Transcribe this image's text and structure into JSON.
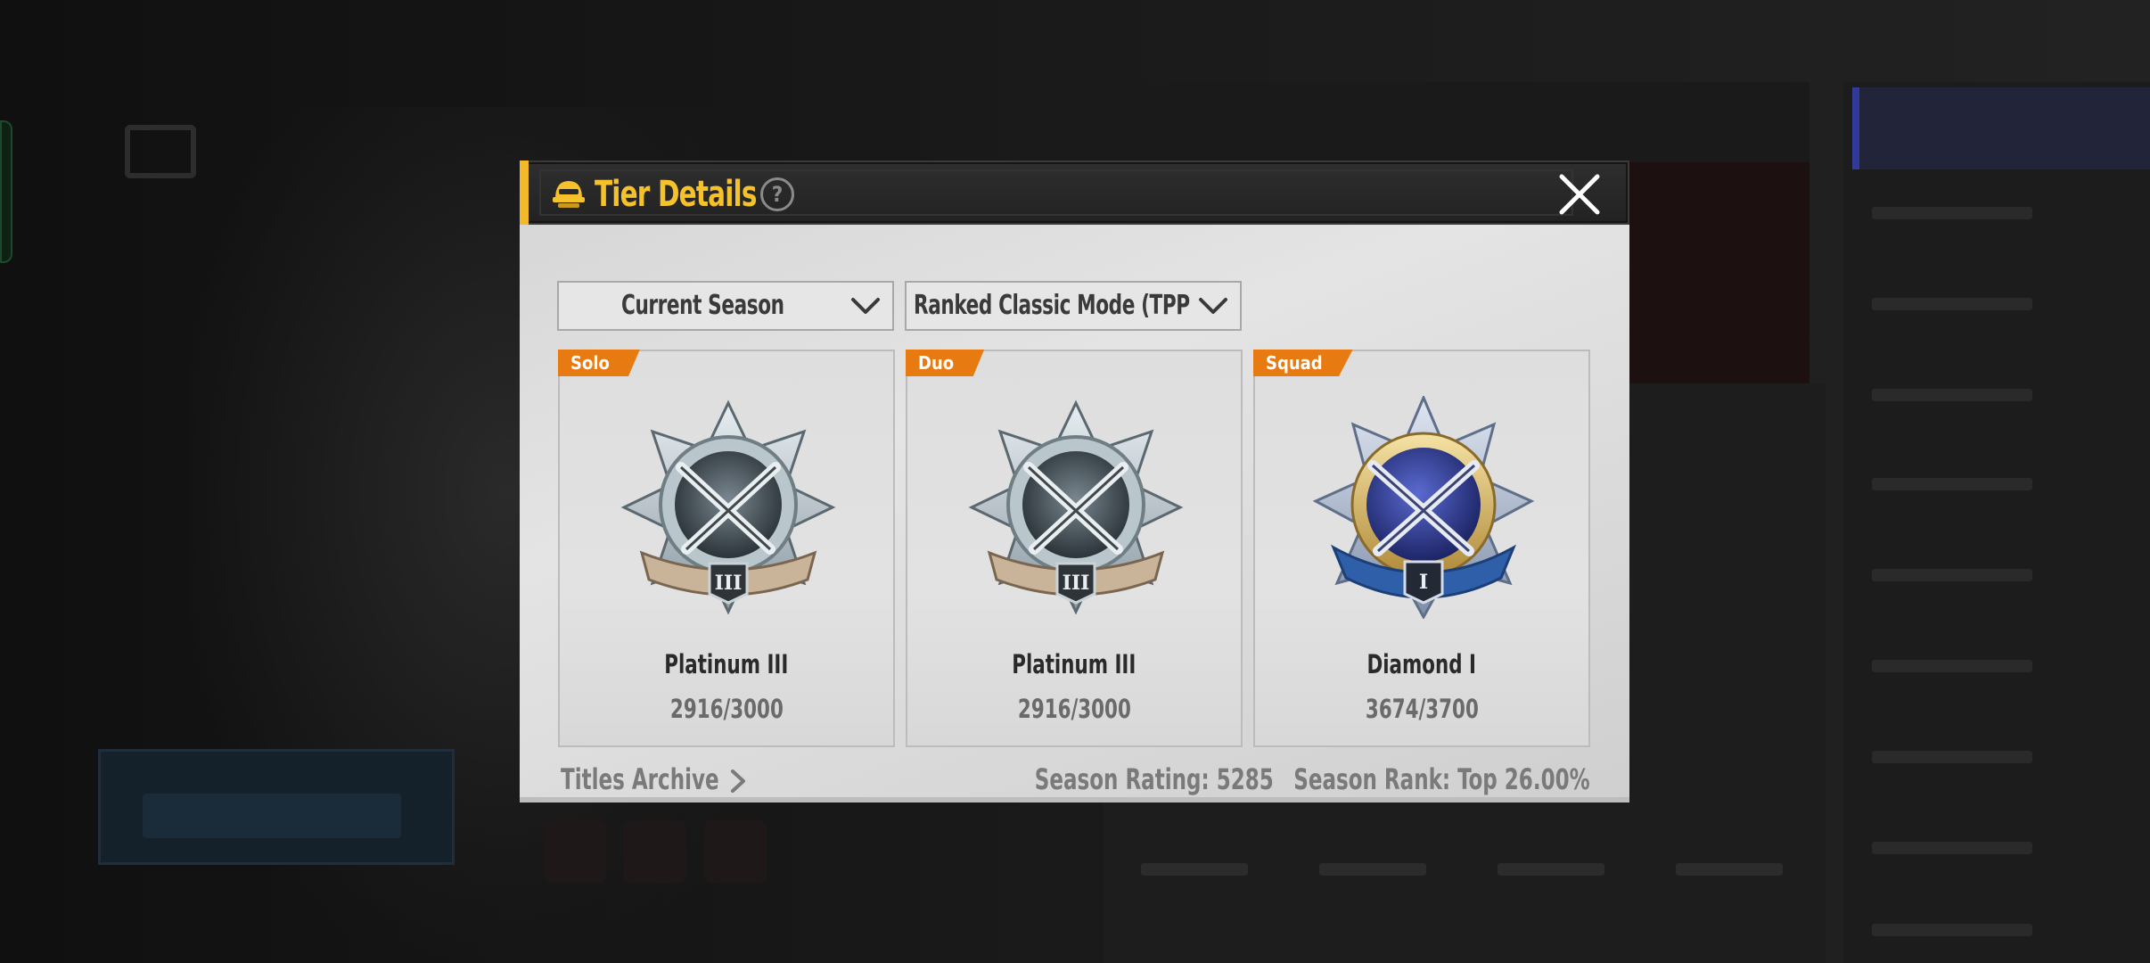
{
  "modal": {
    "title": "Tier Details",
    "help_symbol": "?"
  },
  "filters": {
    "season": "Current Season",
    "mode": "Ranked Classic Mode (TPP"
  },
  "cards": [
    {
      "mode": "Solo",
      "tier": "Platinum III",
      "points": "2916/3000",
      "emblem_roman": "III"
    },
    {
      "mode": "Duo",
      "tier": "Platinum III",
      "points": "2916/3000",
      "emblem_roman": "III"
    },
    {
      "mode": "Squad",
      "tier": "Diamond I",
      "points": "3674/3700",
      "emblem_roman": "I"
    }
  ],
  "footer": {
    "titles_archive": "Titles Archive",
    "season_rating": "Season Rating: 5285",
    "season_rank": "Season Rank: Top 26.00%"
  },
  "colors": {
    "accent": "#f6c22c",
    "mode_tag": "#e87a12",
    "diamond_core": "#2b3a8c"
  },
  "icons": {
    "title_icon": "tier-helmet-icon",
    "help": "question-icon",
    "close": "close-icon",
    "dropdown": "chevron-down-icon",
    "archive_arrow": "chevron-right-icon"
  }
}
